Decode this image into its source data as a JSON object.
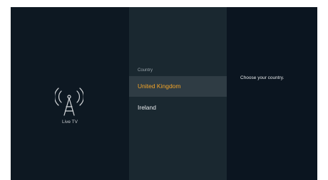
{
  "source": {
    "label": "Live TV",
    "icon": "antenna-icon"
  },
  "country_list": {
    "header": "Country",
    "items": [
      {
        "label": "United Kingdom",
        "selected": true
      },
      {
        "label": "Ireland",
        "selected": false
      }
    ]
  },
  "help": {
    "text": "Choose your country."
  },
  "colors": {
    "background": "#0b1520",
    "panel": "#1a2830",
    "highlight": "#2f3c44",
    "accent": "#f3a427"
  }
}
